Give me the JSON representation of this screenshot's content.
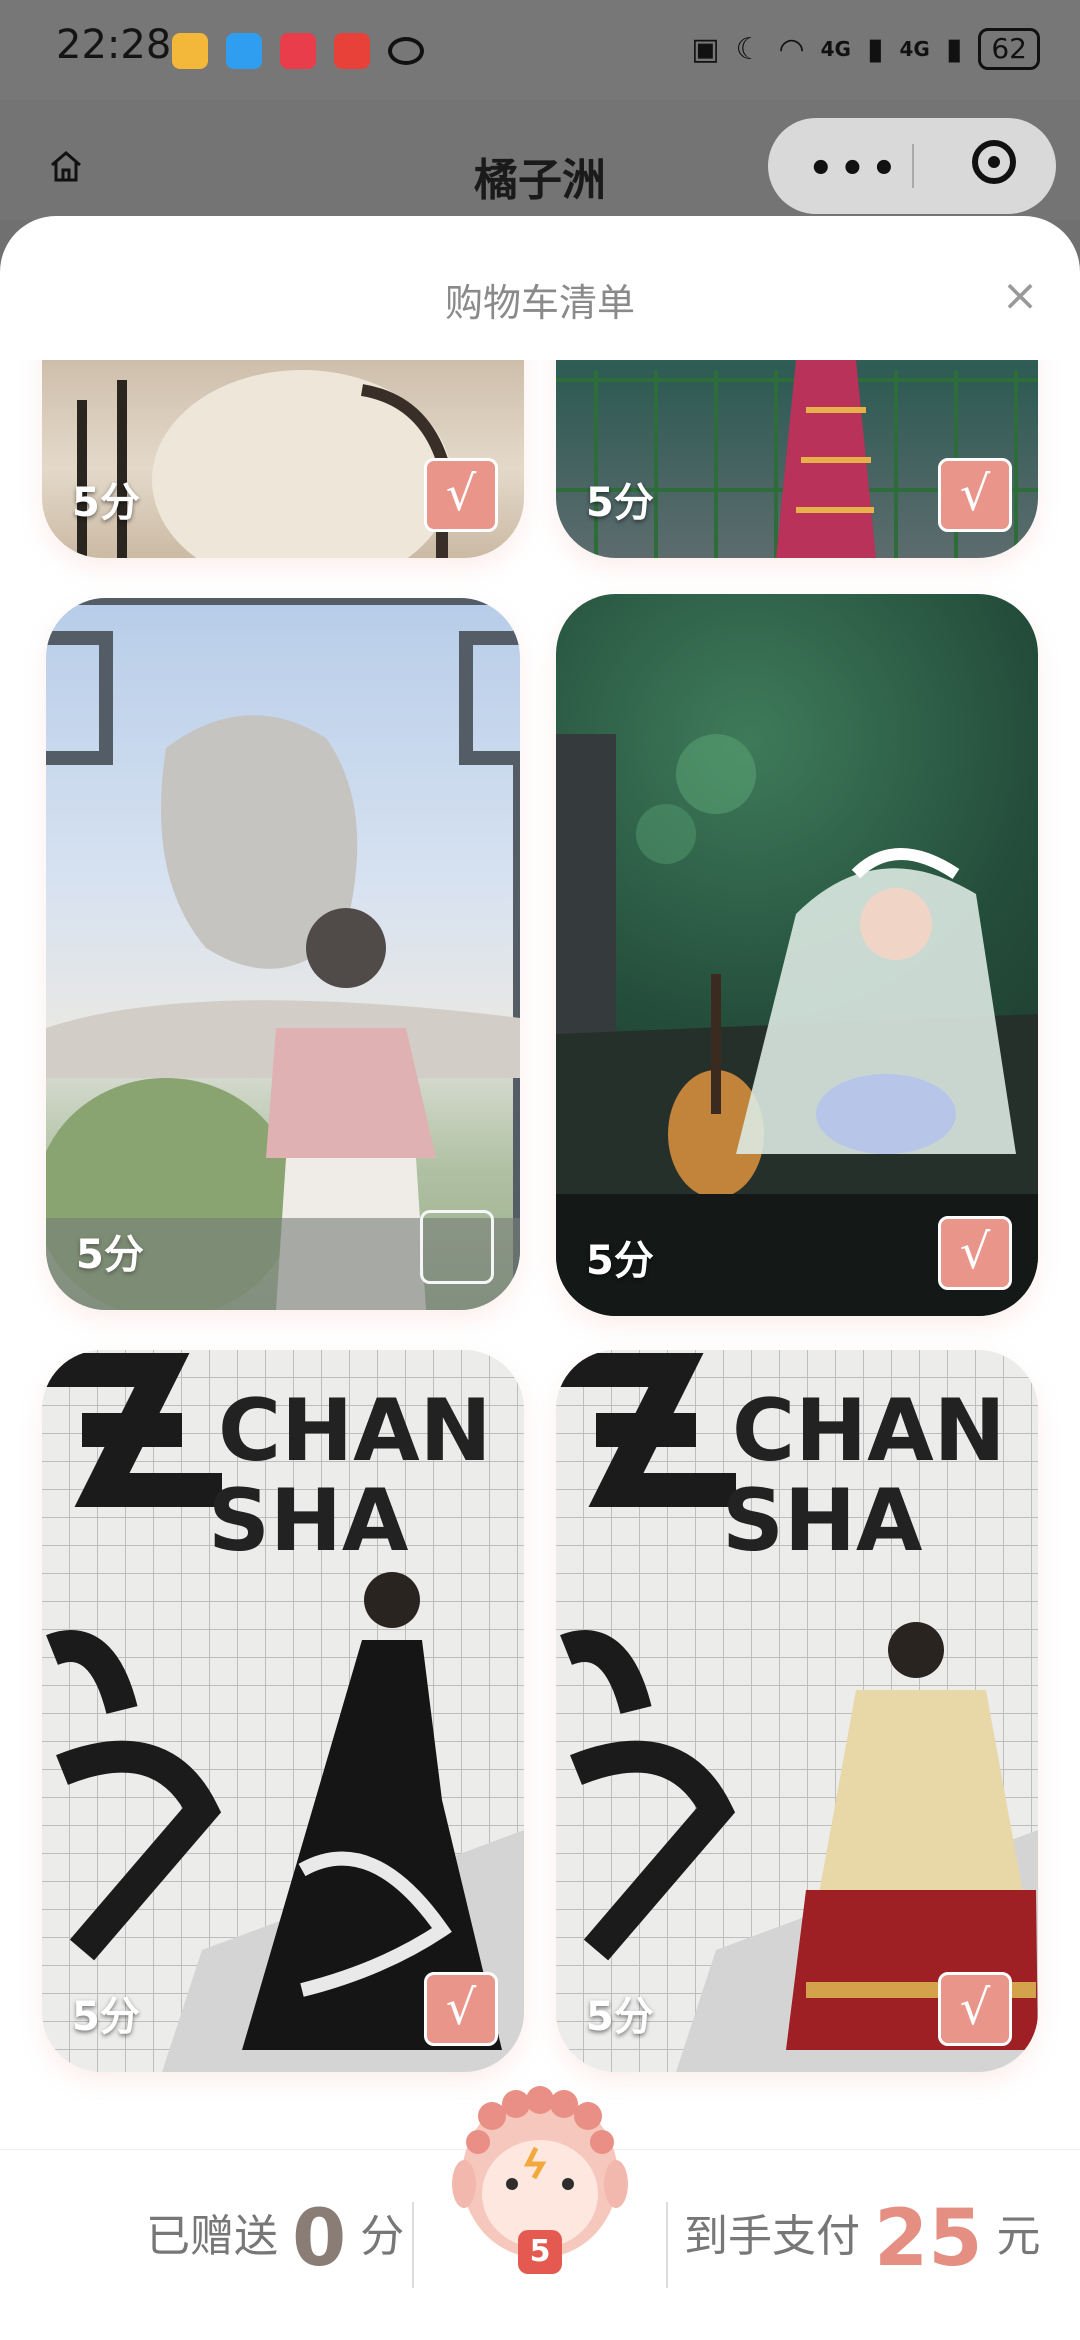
{
  "status_bar": {
    "time": "22:28",
    "battery": "62",
    "network_1": "4G",
    "network_2": "4G"
  },
  "title_bar": {
    "title": "橘子洲"
  },
  "sheet": {
    "title": "购物车清单",
    "close_icon": "×"
  },
  "items": [
    {
      "score": "5分",
      "selected": true
    },
    {
      "score": "5分",
      "selected": true
    },
    {
      "score": "5分",
      "selected": false
    },
    {
      "score": "5分",
      "selected": true
    },
    {
      "score": "5分",
      "selected": true
    },
    {
      "score": "5分",
      "selected": true
    }
  ],
  "checkmark": "√",
  "photo_text": {
    "wall_line1": "CHAN",
    "wall_line2": "SHA"
  },
  "summary": {
    "gifted_label": "已赠送",
    "gifted_value": "0",
    "gifted_unit": "分",
    "pay_label": "到手支付",
    "pay_value": "25",
    "pay_unit": "元",
    "cart_count": "5"
  },
  "colors": {
    "accent": "#e9958a",
    "price": "#e58f83"
  }
}
